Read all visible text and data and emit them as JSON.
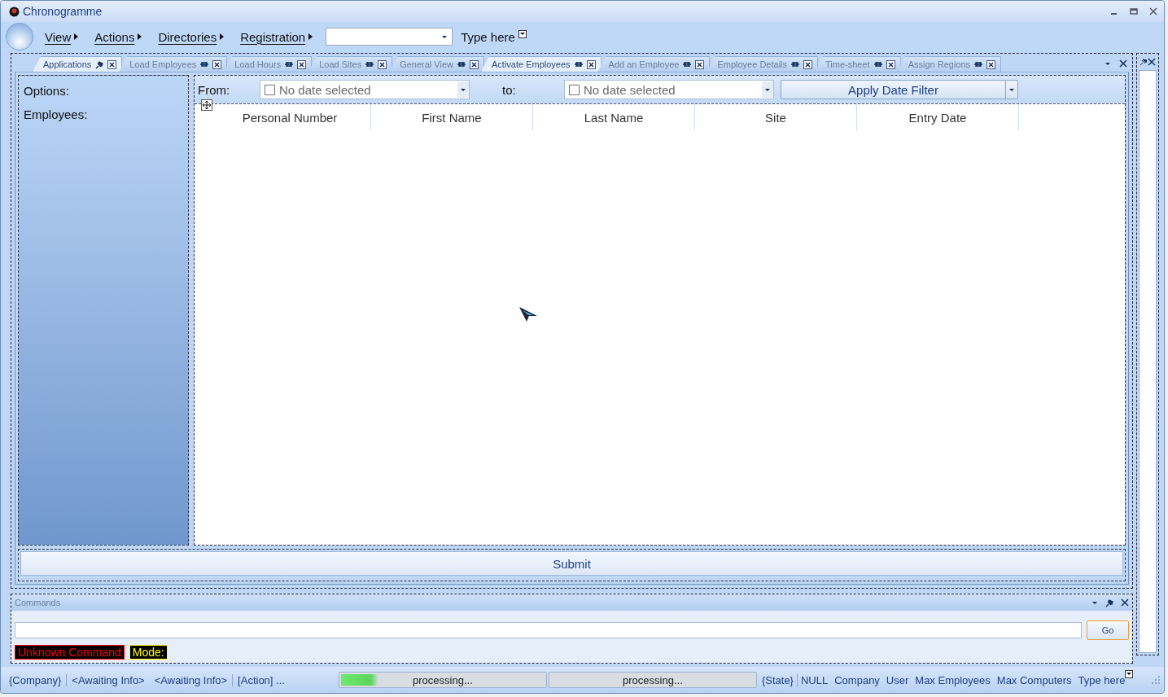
{
  "window": {
    "title": "Chronogramme"
  },
  "menu": [
    {
      "label": "View"
    },
    {
      "label": "Actions"
    },
    {
      "label": "Directories"
    },
    {
      "label": "Registration"
    }
  ],
  "menu_type_here": "Type here",
  "tabs": [
    {
      "label": "Applications",
      "selected": true,
      "pinned": true
    },
    {
      "label": "Load Employees",
      "selected": false,
      "pinned": false
    },
    {
      "label": "Load Hours",
      "selected": false,
      "pinned": false
    },
    {
      "label": "Load Sites",
      "selected": false,
      "pinned": false
    },
    {
      "label": "General View",
      "selected": false,
      "pinned": false
    },
    {
      "label": "Activate Employees",
      "selected": true,
      "pinned": false
    },
    {
      "label": "Add an Employee",
      "selected": false,
      "pinned": false
    },
    {
      "label": "Employee Details",
      "selected": false,
      "pinned": false
    },
    {
      "label": "Time-sheet",
      "selected": false,
      "pinned": false
    },
    {
      "label": "Assign Regions",
      "selected": false,
      "pinned": false
    }
  ],
  "options_panel": {
    "options_label": "Options:",
    "employees_label": "Employees:"
  },
  "date_filter": {
    "from_label": "From:",
    "from": {
      "placeholder": "No date selected",
      "checked": false
    },
    "to_label": "to:",
    "to": {
      "placeholder": "No date selected",
      "checked": false
    },
    "apply_button": "Apply Date Filter"
  },
  "table": {
    "columns": [
      "Personal Number",
      "First Name",
      "Last Name",
      "Site",
      "Entry Date"
    ]
  },
  "submit_button": "Submit",
  "commands": {
    "title": "Commands",
    "go_button": "Go",
    "labels": [
      {
        "text": "Unknown Command",
        "color": "#ff0000"
      },
      {
        "text": "Mode:",
        "color": "#ffff00"
      }
    ]
  },
  "status_bar": {
    "left": [
      "{Company}",
      "<Awaiting Info>",
      "<Awaiting Info>",
      "[Action] ..."
    ],
    "progress": [
      {
        "text": "processing...",
        "level": 0.18
      },
      {
        "text": "processing...",
        "level": 0
      }
    ],
    "right": [
      "{State}",
      "NULL",
      "Company",
      "User",
      "Max Employees",
      "Max Computers",
      "Type here"
    ]
  }
}
